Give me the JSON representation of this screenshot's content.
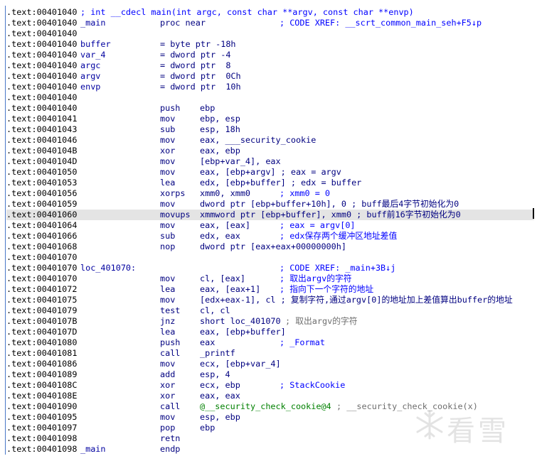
{
  "listing": [
    {
      "addr": ".text:00401040",
      "comment": "; int __cdecl main(int argc, const char **argv, const char **envp)"
    },
    {
      "addr": ".text:00401040",
      "label": "_main",
      "mnem": "proc near",
      "tail": "; CODE XREF: __scrt_common_main_seh+F5↓p",
      "tailx": 384
    },
    {
      "addr": ".text:00401040"
    },
    {
      "addr": ".text:00401040",
      "label": "buffer",
      "mnem": "= byte ptr -18h"
    },
    {
      "addr": ".text:00401040",
      "label": "var_4",
      "mnem": "= dword ptr -4"
    },
    {
      "addr": ".text:00401040",
      "label": "argc",
      "mnem": "= dword ptr  8"
    },
    {
      "addr": ".text:00401040",
      "label": "argv",
      "mnem": "= dword ptr  0Ch"
    },
    {
      "addr": ".text:00401040",
      "label": "envp",
      "mnem": "= dword ptr  10h"
    },
    {
      "addr": ".text:00401040"
    },
    {
      "addr": ".text:00401040",
      "mnem": "push",
      "oper": "ebp"
    },
    {
      "addr": ".text:00401041",
      "mnem": "mov",
      "oper": "ebp, esp"
    },
    {
      "addr": ".text:00401043",
      "mnem": "sub",
      "oper": "esp, 18h"
    },
    {
      "addr": ".text:00401046",
      "mnem": "mov",
      "oper": "eax, ___security_cookie"
    },
    {
      "addr": ".text:0040104B",
      "mnem": "xor",
      "oper": "eax, ebp"
    },
    {
      "addr": ".text:0040104D",
      "mnem": "mov",
      "oper": "[ebp+var_4], eax"
    },
    {
      "addr": ".text:00401050",
      "mnem": "mov",
      "oper": "eax, [ebp+argv] ; eax = argv"
    },
    {
      "addr": ".text:00401053",
      "mnem": "lea",
      "oper": "edx, [ebp+buffer] ; edx = buffer"
    },
    {
      "addr": ".text:00401056",
      "mnem": "xorps",
      "oper": "xmm0, xmm0",
      "tail": "; xmm0 = 0",
      "tailx": 384
    },
    {
      "addr": ".text:00401059",
      "mnem": "mov",
      "oper": "dword ptr [ebp+buffer+10h], 0 ; buff最后4字节初始化为0"
    },
    {
      "addr": ".text:00401060",
      "mnem": "movups",
      "oper": "xmmword ptr [ebp+buffer], xmm0 ; buff前16字节初始化为0",
      "hl": true
    },
    {
      "addr": ".text:00401064",
      "mnem": "mov",
      "oper": "eax, [eax]",
      "tail": "; eax = argv[0]",
      "tailx": 384
    },
    {
      "addr": ".text:00401066",
      "mnem": "sub",
      "oper": "edx, eax",
      "tail": "; edx保存两个缓冲区地址差值",
      "tailx": 384
    },
    {
      "addr": ".text:00401068",
      "mnem": "nop",
      "oper": "dword ptr [eax+eax+00000000h]"
    },
    {
      "addr": ".text:00401070"
    },
    {
      "addr": ".text:00401070",
      "label": "loc_401070:",
      "tail": "; CODE XREF: _main+3B↓j",
      "tailx": 384
    },
    {
      "addr": ".text:00401070",
      "mnem": "mov",
      "oper": "cl, [eax]",
      "tail": "; 取出argv的字符",
      "tailx": 384
    },
    {
      "addr": ".text:00401072",
      "mnem": "lea",
      "oper": "eax, [eax+1]",
      "tail": "; 指向下一个字符的地址",
      "tailx": 384
    },
    {
      "addr": ".text:00401075",
      "mnem": "mov",
      "oper": "[edx+eax-1], cl ; 复制字符,通过argv[0]的地址加上差值算出buffer的地址"
    },
    {
      "addr": ".text:00401079",
      "mnem": "test",
      "oper": "cl, cl"
    },
    {
      "addr": ".text:0040107B",
      "mnem": "jnz",
      "oper": "short loc_401070",
      "tail": "; 取出argv的字符",
      "tailx": 392,
      "tailgray": true
    },
    {
      "addr": ".text:0040107D",
      "mnem": "lea",
      "oper": "eax, [ebp+buffer]"
    },
    {
      "addr": ".text:00401080",
      "mnem": "push",
      "oper": "eax",
      "tail": "; _Format",
      "tailx": 384
    },
    {
      "addr": ".text:00401081",
      "mnem": "call",
      "oper": "_printf"
    },
    {
      "addr": ".text:00401086",
      "mnem": "mov",
      "oper": "ecx, [ebp+var_4]"
    },
    {
      "addr": ".text:00401089",
      "mnem": "add",
      "oper": "esp, 4"
    },
    {
      "addr": ".text:0040108C",
      "mnem": "xor",
      "oper": "ecx, ebp",
      "tail": "; StackCookie",
      "tailx": 384
    },
    {
      "addr": ".text:0040108E",
      "mnem": "xor",
      "oper": "eax, eax"
    },
    {
      "addr": ".text:00401090",
      "mnem": "call",
      "oper": "@__security_check_cookie@4",
      "tail": "; __security_check_cookie(x)",
      "tailx": 464,
      "tailgray": true,
      "opergreen": true
    },
    {
      "addr": ".text:00401095",
      "mnem": "mov",
      "oper": "esp, ebp"
    },
    {
      "addr": ".text:00401097",
      "mnem": "pop",
      "oper": "ebp"
    },
    {
      "addr": ".text:00401098",
      "mnem": "retn"
    },
    {
      "addr": ".text:00401098",
      "label": "_main",
      "mnem": "endp"
    }
  ],
  "watermark": {
    "text": "看雪",
    "icon": "snowflake-icon"
  },
  "colors": {
    "address": "#000000",
    "code": "#000080",
    "comment": "#0000ff",
    "highlight": "#e4e4e4"
  }
}
